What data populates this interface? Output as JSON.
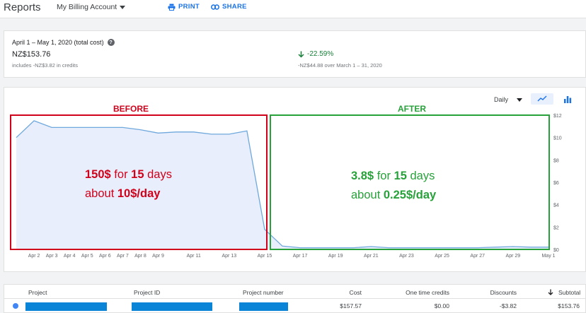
{
  "header": {
    "title": "Reports",
    "account": "My Billing Account",
    "print_label": "PRINT",
    "share_label": "SHARE"
  },
  "summary": {
    "period": "April 1 – May 1, 2020 (total cost)",
    "total": "NZ$153.76",
    "credits_note": "includes -NZ$3.82 in credits",
    "change": "-22.59%",
    "previous": "-NZ$44.88 over March 1 – 31, 2020"
  },
  "controls": {
    "granularity": "Daily",
    "line_icon": "line-chart-icon",
    "bar_icon": "bar-chart-icon"
  },
  "colors": {
    "accent": "#1a73e8",
    "line": "#6fa8dc",
    "area": "#e8eefc",
    "before": "#d0021b",
    "after": "#27a13a",
    "positive": "#188038"
  },
  "chart_data": {
    "type": "area",
    "x": [
      "Apr 1",
      "Apr 2",
      "Apr 3",
      "Apr 4",
      "Apr 5",
      "Apr 6",
      "Apr 7",
      "Apr 8",
      "Apr 9",
      "Apr 10",
      "Apr 11",
      "Apr 12",
      "Apr 13",
      "Apr 14",
      "Apr 15",
      "Apr 16",
      "Apr 17",
      "Apr 18",
      "Apr 19",
      "Apr 20",
      "Apr 21",
      "Apr 22",
      "Apr 23",
      "Apr 24",
      "Apr 25",
      "Apr 26",
      "Apr 27",
      "Apr 28",
      "Apr 29",
      "Apr 30",
      "May 1"
    ],
    "x_tick_labels": [
      "Apr 2",
      "Apr 3",
      "Apr 4",
      "Apr 5",
      "Apr 6",
      "Apr 7",
      "Apr 8",
      "Apr 9",
      "Apr 11",
      "Apr 13",
      "Apr 15",
      "Apr 17",
      "Apr 19",
      "Apr 21",
      "Apr 23",
      "Apr 25",
      "Apr 27",
      "Apr 29",
      "May 1"
    ],
    "series": [
      {
        "values": [
          10.0,
          11.5,
          10.9,
          10.9,
          10.9,
          10.9,
          10.9,
          10.7,
          10.4,
          10.5,
          10.5,
          10.3,
          10.3,
          10.6,
          1.8,
          0.3,
          0.15,
          0.15,
          0.15,
          0.15,
          0.25,
          0.15,
          0.15,
          0.15,
          0.15,
          0.15,
          0.15,
          0.2,
          0.25,
          0.2,
          0.2
        ]
      }
    ],
    "y_ticks": [
      "$0",
      "$2",
      "$4",
      "$6",
      "$8",
      "$10",
      "$12"
    ],
    "ylim": [
      0,
      12
    ],
    "grid": false
  },
  "annotations": {
    "before_title": "BEFORE",
    "after_title": "AFTER",
    "before_line1_amount": "150$",
    "before_line1_mid": " for ",
    "before_line1_num": "15",
    "before_line1_end": " days",
    "before_line2_pre": "about ",
    "before_line2_rate": "10$/day",
    "after_line1_amount": "3.8$",
    "after_line1_mid": " for ",
    "after_line1_num": "15",
    "after_line1_end": " days",
    "after_line2_pre": "about ",
    "after_line2_rate": "0.25$/day"
  },
  "table": {
    "headers": {
      "project": "Project",
      "project_id": "Project ID",
      "project_number": "Project number",
      "cost": "Cost",
      "credits": "One time credits",
      "discounts": "Discounts",
      "subtotal": "Subtotal"
    },
    "row": {
      "cost": "$157.57",
      "credits": "$0.00",
      "discounts": "-$3.82",
      "subtotal": "$153.76"
    }
  }
}
